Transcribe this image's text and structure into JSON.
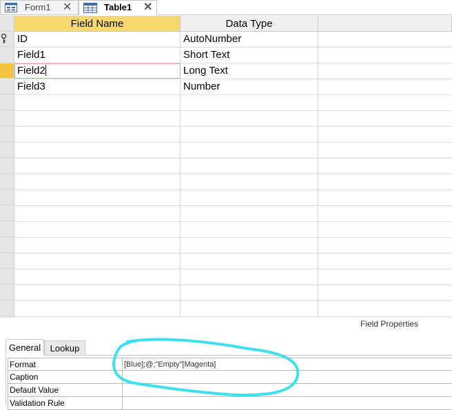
{
  "tabs": [
    {
      "label": "Form1",
      "icon": "form-icon",
      "active": false
    },
    {
      "label": "Table1",
      "icon": "table-icon",
      "active": true
    }
  ],
  "grid": {
    "columns": [
      "Field Name",
      "Data Type"
    ],
    "rows": [
      {
        "field": "ID",
        "type": "AutoNumber",
        "primary_key": true
      },
      {
        "field": "Field1",
        "type": "Short Text"
      },
      {
        "field": "Field2",
        "type": "Long Text",
        "current": true
      },
      {
        "field": "Field3",
        "type": "Number"
      }
    ]
  },
  "field_properties": {
    "title": "Field Properties",
    "tabs": [
      "General",
      "Lookup"
    ],
    "rows": [
      {
        "name": "Format",
        "value": "[Blue];@;\"Empty\"[Magenta]"
      },
      {
        "name": "Caption",
        "value": ""
      },
      {
        "name": "Default Value",
        "value": ""
      },
      {
        "name": "Validation Rule",
        "value": ""
      }
    ]
  },
  "colors": {
    "header_active": "#f8d86e",
    "row_selector_current": "#f5c342",
    "annotation_stroke": "#3fe0ee"
  }
}
